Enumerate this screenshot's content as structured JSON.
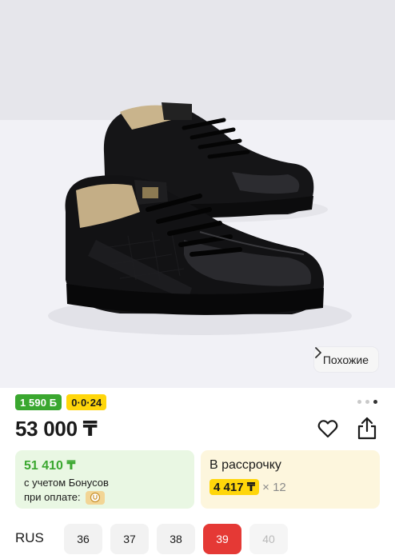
{
  "product_image": {
    "alt_icon": "sneakers-photo"
  },
  "similar_button": {
    "label": "Похожие"
  },
  "badges": {
    "bonus": "1 590 Б",
    "installment": "0·0·24"
  },
  "gallery": {
    "total": 3,
    "active_index": 2
  },
  "price": "53 000 ₸",
  "bonus_card": {
    "amount": "51 410 ₸",
    "line1": "с учетом Бонусов",
    "line2": "при оплате:"
  },
  "credit_card": {
    "title": "В рассрочку",
    "amount": "4 417 ₸",
    "multiplier": "× 12"
  },
  "sizes": {
    "label": "RUS",
    "options": [
      "36",
      "37",
      "38",
      "39",
      "40"
    ],
    "selected": "39",
    "disabled": [
      "40"
    ]
  },
  "colors": {
    "accent_green": "#3aa72f",
    "accent_yellow": "#ffd60a",
    "selected_red": "#e53935"
  }
}
